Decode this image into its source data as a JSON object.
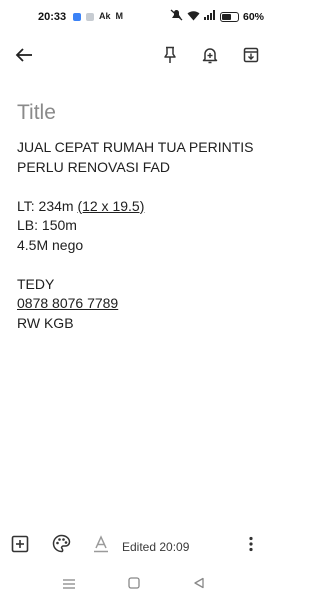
{
  "status_bar": {
    "time": "20:33",
    "notification_icons": [
      {
        "icon": "app-blue-icon",
        "color": "#3b82f6"
      },
      {
        "icon": "app-chat-icon",
        "color": "#9aa3ad"
      },
      {
        "icon": "app-ak-icon",
        "text": "Ak"
      },
      {
        "icon": "gmail-icon",
        "text": "M"
      }
    ],
    "battery_percent": "60%",
    "battery_level": 0.6
  },
  "toolbar": {
    "back_icon": "arrow-left-icon",
    "pin_icon": "pin-icon",
    "reminder_icon": "bell-plus-icon",
    "archive_icon": "archive-icon"
  },
  "note": {
    "title_placeholder": "Title",
    "lines": [
      "JUAL CEPAT RUMAH TUA PERINTIS",
      "PERLU RENOVASI FAD",
      "",
      "LT: 234m ",
      "(12 x 19.5)",
      "LB: 150m",
      "4.5M nego",
      "",
      "TEDY",
      "0878 8076 7789",
      "RW KGB"
    ]
  },
  "bottom_bar": {
    "add_icon": "add-box-icon",
    "palette_icon": "palette-icon",
    "text_format_icon": "text-format-icon",
    "edited_text": "Edited 20:09",
    "more_icon": "more-vert-icon"
  },
  "nav_bar": {
    "menu_icon": "menu-icon",
    "home_icon": "home-square-icon",
    "back_icon": "back-triangle-icon"
  },
  "colors": {
    "title_placeholder": "#8a8a8a",
    "text": "#202020",
    "background": "#ffffff"
  }
}
